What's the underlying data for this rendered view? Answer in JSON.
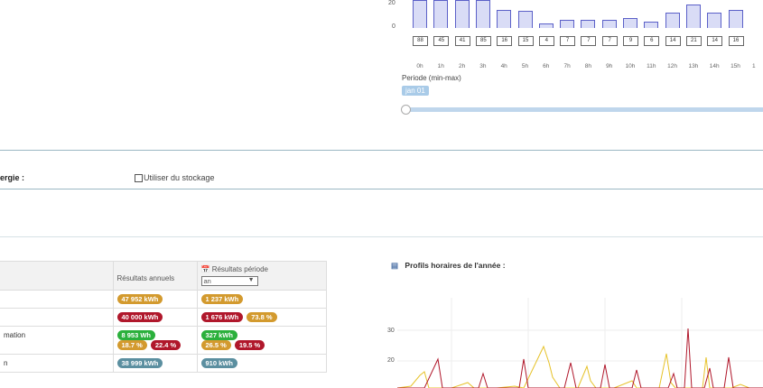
{
  "hour_chart": {
    "y_ticks": [
      "20",
      "0"
    ],
    "bars": [
      {
        "hour": "0h",
        "value": 88
      },
      {
        "hour": "1h",
        "value": 45
      },
      {
        "hour": "2h",
        "value": 41
      },
      {
        "hour": "3h",
        "value": 85
      },
      {
        "hour": "4h",
        "value": 16
      },
      {
        "hour": "5h",
        "value": 15
      },
      {
        "hour": "6h",
        "value": 4
      },
      {
        "hour": "7h",
        "value": 7
      },
      {
        "hour": "8h",
        "value": 7
      },
      {
        "hour": "9h",
        "value": 7
      },
      {
        "hour": "10h",
        "value": 9
      },
      {
        "hour": "11h",
        "value": 6
      },
      {
        "hour": "12h",
        "value": 14
      },
      {
        "hour": "13h",
        "value": 21
      },
      {
        "hour": "14h",
        "value": 14
      },
      {
        "hour": "15h",
        "value": 16
      }
    ],
    "partial_label": "1"
  },
  "period": {
    "label": "Periode (min-max)",
    "value": "jan 01"
  },
  "energy_section": {
    "label": "ergie :",
    "storage_label": "Utiliser du stockage"
  },
  "results_table": {
    "header_annual": "Résultats annuels",
    "header_period": "Résultats période",
    "period_select": "an",
    "rows": [
      {
        "label": "",
        "annual": [
          {
            "t": "47 952 kWh",
            "c": "y"
          }
        ],
        "period": [
          {
            "t": "1 237 kWh",
            "c": "y"
          }
        ]
      },
      {
        "label": "",
        "annual": [
          {
            "t": "40 000 kWh",
            "c": "r"
          }
        ],
        "period": [
          {
            "t": "1 676 kWh",
            "c": "r"
          },
          {
            "t": "73.8 %",
            "c": "y"
          }
        ]
      },
      {
        "label": "mation",
        "annual": [
          {
            "t": "8 953 Wh",
            "c": "g"
          },
          {
            "t": "18.7 %",
            "c": "y"
          },
          {
            "t": "22.4 %",
            "c": "r"
          }
        ],
        "period": [
          {
            "t": "327 kWh",
            "c": "g"
          },
          {
            "t": "26.5 %",
            "c": "y"
          },
          {
            "t": "19.5 %",
            "c": "r"
          }
        ]
      },
      {
        "label": "n",
        "annual": [
          {
            "t": "38 999 kWh",
            "c": "b"
          }
        ],
        "period": [
          {
            "t": "910 kWh",
            "c": "b"
          }
        ]
      }
    ]
  },
  "profile_chart": {
    "title": "Profils horaires de l'année :",
    "y_ticks": [
      "30",
      "20"
    ]
  }
}
